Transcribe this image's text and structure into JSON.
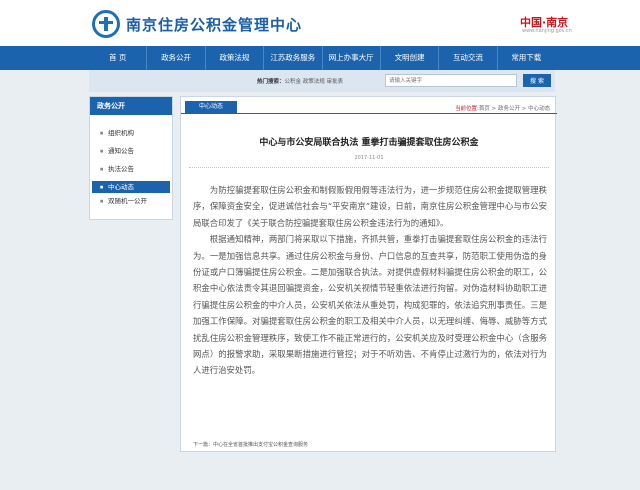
{
  "header": {
    "site_title": "南京住房公积金管理中心",
    "partner": "中国·南京",
    "partner_url": "www.nanjing.gov.cn"
  },
  "nav": {
    "items": [
      "首 页",
      "政务公开",
      "政策法规",
      "江苏政务服务",
      "网上办事大厅",
      "文明创建",
      "互动交流",
      "常用下载"
    ]
  },
  "search": {
    "hot_label": "热门搜索：",
    "hot_words": "公积金 政策法规 审批表",
    "placeholder": "请输入关键字",
    "button": "搜 索"
  },
  "sidebar": {
    "title": "政务公开",
    "items": [
      {
        "label": "组织机构"
      },
      {
        "label": "通知公告"
      },
      {
        "label": "执法公告"
      },
      {
        "label": "中心动态"
      },
      {
        "label": "双随机一公开"
      }
    ]
  },
  "content": {
    "tab": "中心动态",
    "breadcrumb_label": "当前位置:",
    "breadcrumb_path": "首页 > 政务公开 > 中心动态",
    "title": "中心与市公安局联合执法 重拳打击骗提套取住房公积金",
    "date": "2017-11-01",
    "paragraphs": [
      "为防控骗提套取住房公积金和制假贩假用假等违法行为，进一步规范住房公积金提取管理秩序，保障资金安全，促进诚信社会与“平安南京”建设，日前，南京住房公积金管理中心与市公安局联合印发了《关于联合防控骗提套取住房公积金违法行为的通知》。",
      "根据通知精神，两部门将采取以下措施，齐抓共管，重拳打击骗提套取住房公积金的违法行为。一是加强信息共享。通过住房公积金与身份、户口信息的互查共享，防范职工使用伪造的身份证或户口簿骗提住房公积金。二是加强联合执法。对提供虚假材料骗提住房公积金的职工，公积金中心依法责令其退回骗提资金，公安机关视情节轻重依法进行拘留。对伪造材料协助职工进行骗提住房公积金的中介人员，公安机关依法从重处罚，构成犯罪的，依法追究刑事责任。三是加强工作保障。对骗提套取住房公积金的职工及相关中介人员，以无理纠缠、侮辱、威胁等方式扰乱住房公积金管理秩序，致使工作不能正常进行的，公安机关应及时受理公积金中心（含服务网点）的报警求助，采取果断措施进行管控；对于不听劝告、不肯停止过激行为的，依法对行为人进行治安处罚。"
    ],
    "next_label": "下一篇：",
    "next_title": "中心在全省首批推出支付宝公积金查询服务"
  }
}
